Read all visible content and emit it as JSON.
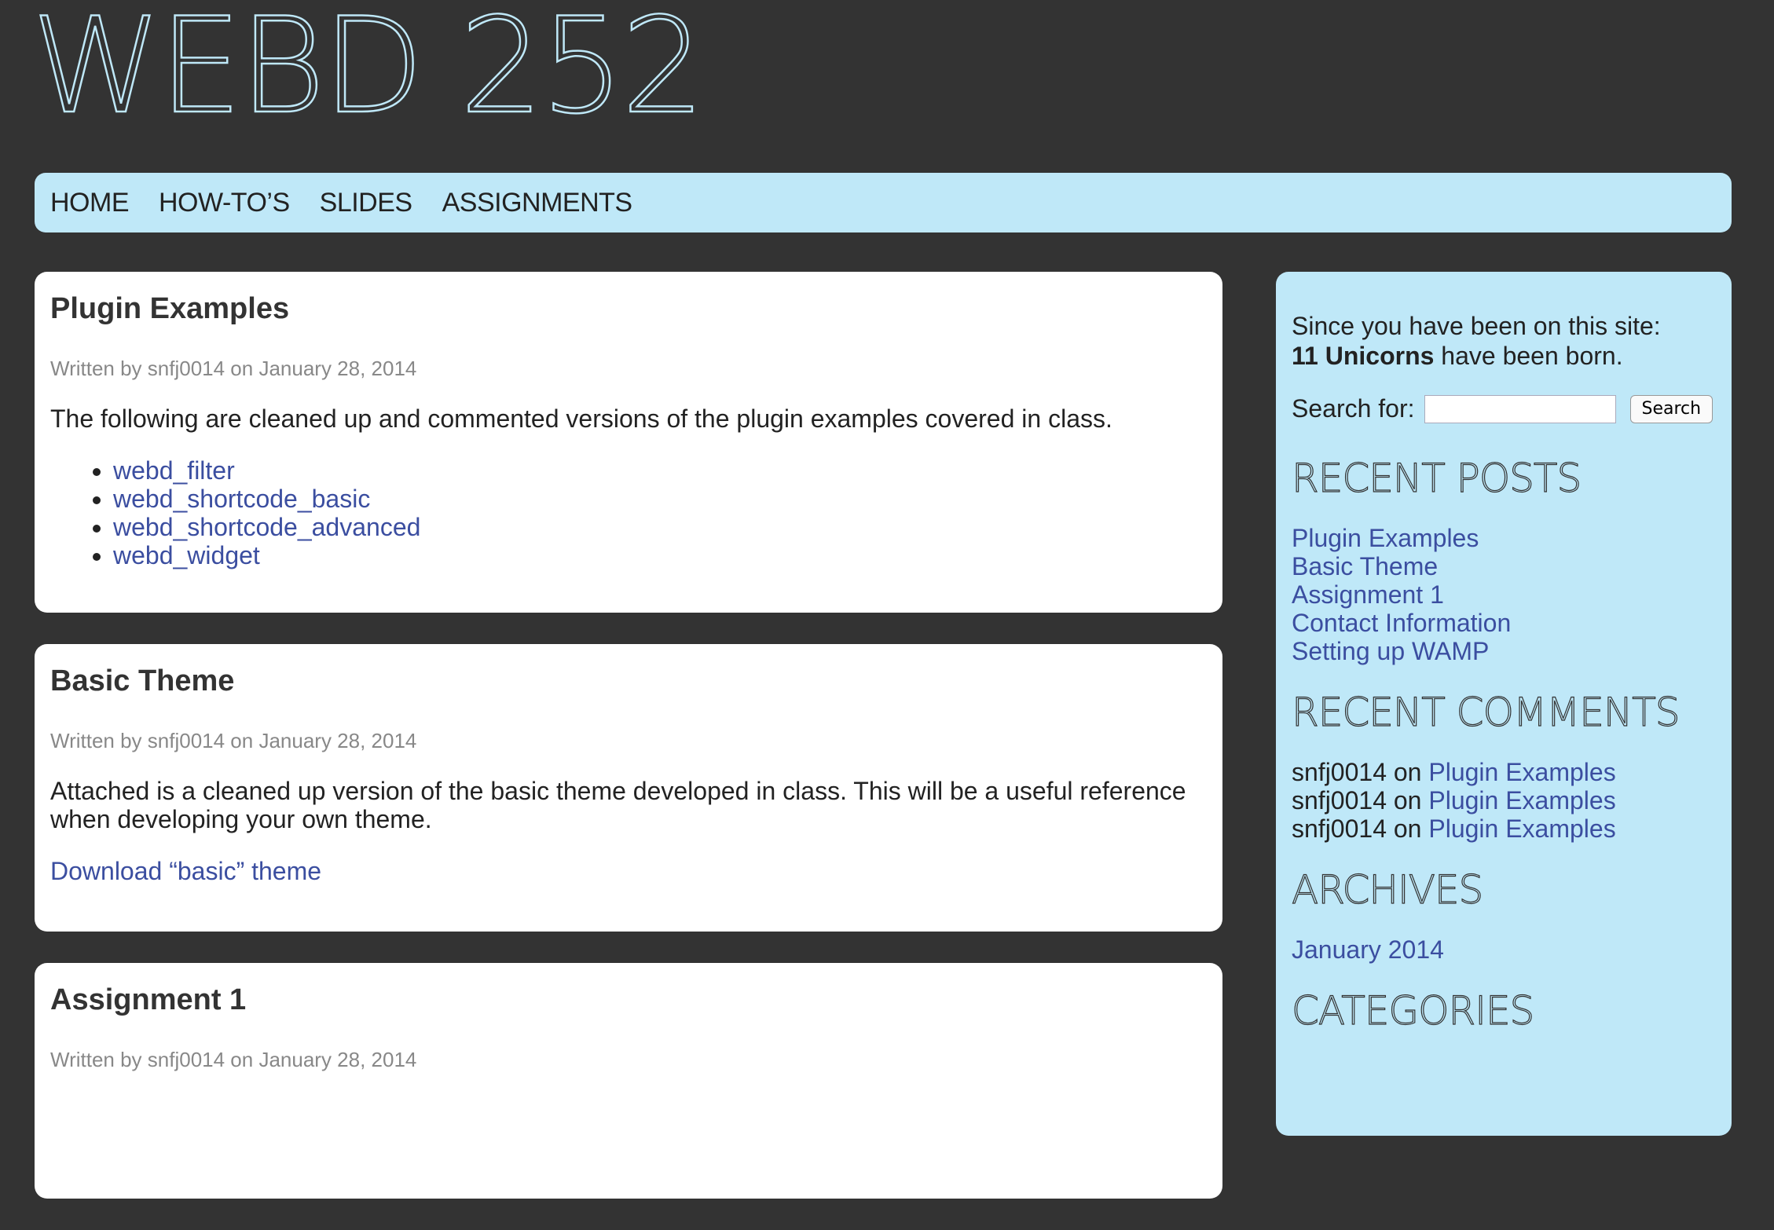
{
  "site": {
    "title": "WEBD 252"
  },
  "nav": [
    {
      "label": "HOME"
    },
    {
      "label": "HOW-TO’S"
    },
    {
      "label": "SLIDES"
    },
    {
      "label": "ASSIGNMENTS"
    }
  ],
  "posts": [
    {
      "title": "Plugin Examples",
      "meta": "Written by snfj0014 on January 28, 2014",
      "body": "The following are cleaned up and commented versions of the plugin examples covered in class.",
      "links": [
        "webd_filter",
        "webd_shortcode_basic",
        "webd_shortcode_advanced",
        "webd_widget"
      ]
    },
    {
      "title": "Basic Theme",
      "meta": "Written by snfj0014 on January 28, 2014",
      "body": "Attached is a cleaned up version of the basic theme developed in class. This will be a useful reference when developing your own theme.",
      "download_link": "Download “basic” theme"
    },
    {
      "title": "Assignment 1",
      "meta": "Written by snfj0014 on January 28, 2014"
    }
  ],
  "sidebar": {
    "unicorn_line1": "Since you have been on this site:",
    "unicorn_count": "11 Unicorns",
    "unicorn_suffix": " have been born.",
    "search_label": "Search for:",
    "search_value": "",
    "search_button": "Search",
    "recent_posts_title": "RECENT POSTS",
    "recent_posts": [
      "Plugin Examples",
      "Basic Theme",
      "Assignment 1",
      "Contact Information",
      "Setting up WAMP"
    ],
    "recent_comments_title": "RECENT COMMENTS",
    "recent_comments": [
      {
        "author": "snfj0014",
        "on": " on ",
        "post": "Plugin Examples"
      },
      {
        "author": "snfj0014",
        "on": " on ",
        "post": "Plugin Examples"
      },
      {
        "author": "snfj0014",
        "on": " on ",
        "post": "Plugin Examples"
      }
    ],
    "archives_title": "ARCHIVES",
    "archives": [
      "January 2014"
    ],
    "categories_title": "CATEGORIES"
  }
}
